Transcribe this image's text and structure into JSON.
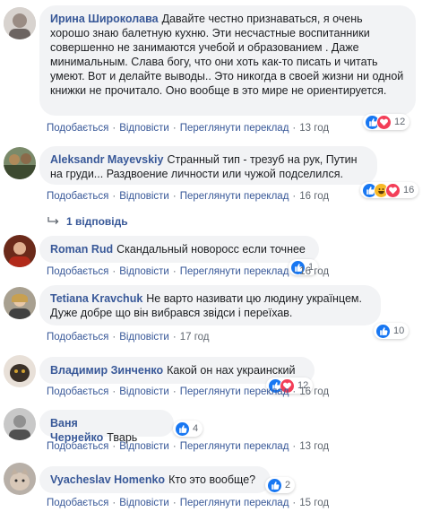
{
  "actions": {
    "like": "Подобається",
    "reply": "Відповісти",
    "translate": "Переглянути переклад"
  },
  "comments": [
    {
      "author": "Ирина Широколава",
      "text": "Давайте честно признаваться, я очень хорошо знаю балетную кухню. Эти несчастные воспитанники совершенно не занимаются учебой и образованием . Даже минимальным. Слава богу, что они хоть как-то писать и читать умеют. Вот и делайте выводы.. Это никогда в своей жизни ни одной книжки не прочитало. Оно вообще в это мире не ориентируется.",
      "time": "13 год",
      "reactions": "12",
      "reaction_icons": [
        "like-icon",
        "love-icon"
      ]
    },
    {
      "author": "Aleksandr Mayevskiy",
      "text": "Странный тип - трезуб на рук, Путин на груди... Раздвоение личности или чужой подселился.",
      "time": "16 год",
      "reactions": "16",
      "reaction_icons": [
        "like-icon",
        "haha-icon",
        "love-icon"
      ],
      "replies": "1 відповідь"
    },
    {
      "author": "Roman Rud",
      "text": "Скандальный новоросс если точнее",
      "time": "16 год",
      "reactions": "1",
      "reaction_icons": [
        "like-icon"
      ]
    },
    {
      "author": "Tetiana Kravchuk",
      "text": "Не варто називати цю людину українцем. Дуже добре що він вибрався звідси і переїхав.",
      "time": "17 год",
      "reactions": "10",
      "reaction_icons": [
        "like-icon"
      ]
    },
    {
      "author": "Владимир Зинченко",
      "text": "Какой он нах украинский",
      "time": "16 год",
      "reactions": "12",
      "reaction_icons": [
        "like-icon",
        "love-icon"
      ]
    },
    {
      "author": "Ваня Чернейко",
      "text": "Тварь",
      "time": "13 год",
      "reactions": "4",
      "reaction_icons": [
        "like-icon"
      ]
    },
    {
      "author": "Vyacheslav Homenko",
      "text": "Кто это вообще?",
      "time": "15 год",
      "reactions": "2",
      "reaction_icons": [
        "like-icon"
      ]
    }
  ],
  "colors": {
    "link": "#385898",
    "bubble": "#f2f3f5",
    "like": "#1877f2",
    "love": "#f33e58"
  }
}
